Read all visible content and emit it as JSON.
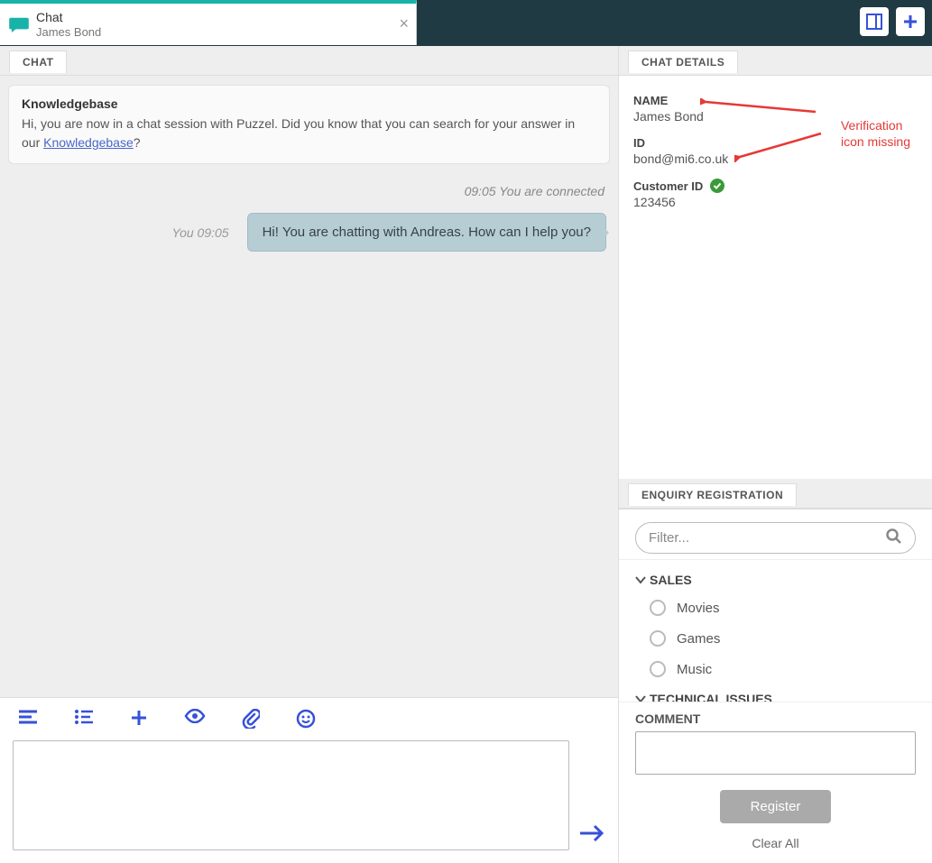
{
  "topbar": {
    "tab": {
      "title": "Chat",
      "subtitle": "James Bond"
    }
  },
  "chat": {
    "tab_label": "CHAT",
    "kb": {
      "title": "Knowledgebase",
      "text_before": "Hi, you are now in a chat session with Puzzel. Did you know that you can search for your answer in our ",
      "link_text": "Knowledgebase",
      "text_after": "?"
    },
    "system_message": "09:05 You are connected",
    "message": {
      "meta": "You 09:05",
      "text": "Hi! You are chatting with Andreas. How can I help you?"
    }
  },
  "details": {
    "tab_label": "CHAT DETAILS",
    "name_label": "NAME",
    "name_value": "James Bond",
    "id_label": "ID",
    "id_value": "bond@mi6.co.uk",
    "customer_id_label": "Customer ID",
    "customer_id_value": "123456",
    "annotation_line1": "Verification",
    "annotation_line2": "icon missing"
  },
  "enquiry": {
    "tab_label": "ENQUIRY REGISTRATION",
    "filter_placeholder": "Filter...",
    "categories": [
      {
        "name": "SALES",
        "items": [
          "Movies",
          "Games",
          "Music"
        ]
      },
      {
        "name": "TECHNICAL ISSUES",
        "items": []
      }
    ],
    "comment_label": "COMMENT",
    "register_label": "Register",
    "clear_label": "Clear All"
  }
}
